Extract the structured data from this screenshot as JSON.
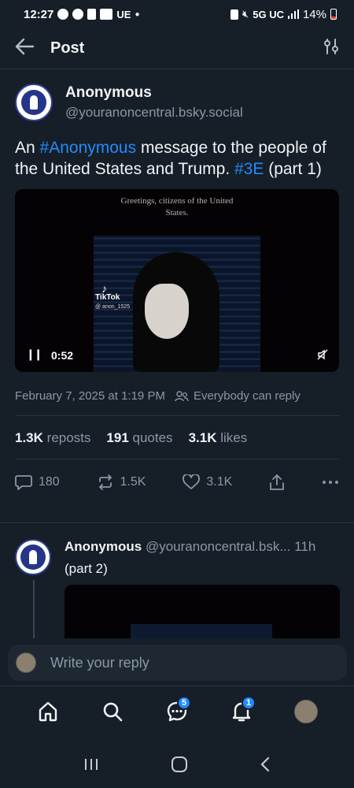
{
  "statusbar": {
    "time": "12:27",
    "carrier_badge": "UE",
    "network": "5G UC",
    "battery": "14%"
  },
  "header": {
    "title": "Post"
  },
  "post": {
    "author": {
      "display_name": "Anonymous",
      "handle": "@youranoncentral.bsky.social"
    },
    "text_parts": {
      "p1": "An ",
      "hashtag1": "#Anonymous",
      "p2": " message to the people of the United States and Trump. ",
      "hashtag2": "#3E",
      "p3": " (part 1)"
    },
    "video": {
      "caption": "Greetings, citizens of the United States.",
      "watermark": "TikTok",
      "watermark_user": "@ anon_1525",
      "duration": "0:52"
    },
    "timestamp": "February 7, 2025 at 1:19 PM",
    "reply_permission": "Everybody can reply",
    "stats": {
      "reposts_count": "1.3K",
      "reposts_label": "reposts",
      "quotes_count": "191",
      "quotes_label": "quotes",
      "likes_count": "3.1K",
      "likes_label": "likes"
    },
    "actions": {
      "replies": "180",
      "reposts": "1.5K",
      "likes": "3.1K"
    }
  },
  "reply": {
    "display_name": "Anonymous",
    "handle_time": "@youranoncentral.bsk... 11h",
    "text": "(part 2)"
  },
  "compose": {
    "placeholder": "Write your reply"
  },
  "tabbar": {
    "chat_badge": "5",
    "notif_badge": "1"
  },
  "colors": {
    "background": "#161e27",
    "accent": "#208bfe",
    "muted": "#8b98a5"
  }
}
